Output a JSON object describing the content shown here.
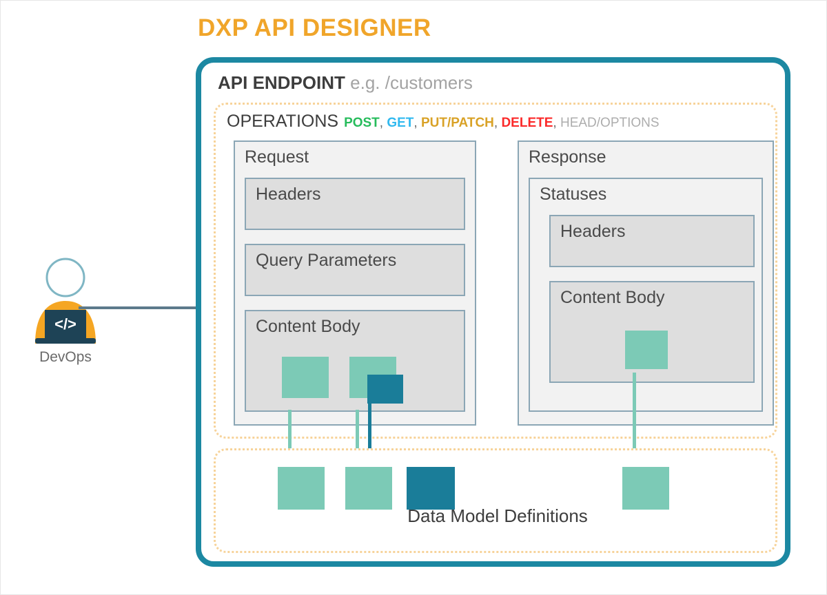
{
  "title": "DXP API DESIGNER",
  "actor": {
    "label": "DevOps",
    "icon": "developer-avatar-icon",
    "code_glyph": "</>",
    "shirt_color": "#f5a623",
    "laptop_color": "#1e4356"
  },
  "endpoint": {
    "title_strong": "API ENDPOINT",
    "title_muted": "e.g. /customers"
  },
  "operations": {
    "label": "OPERATIONS",
    "methods": [
      {
        "name": "POST",
        "color": "#27bc5c"
      },
      {
        "name": "GET",
        "color": "#31b9ef"
      },
      {
        "name": "PUT/PATCH",
        "color": "#d9a227"
      },
      {
        "name": "DELETE",
        "color": "#fb2a2a"
      },
      {
        "name": "HEAD/OPTIONS",
        "color": "#adadad"
      }
    ],
    "separator": ", "
  },
  "request": {
    "label": "Request",
    "items": [
      {
        "label": "Headers"
      },
      {
        "label": "Query Parameters"
      },
      {
        "label": "Content Body"
      }
    ]
  },
  "response": {
    "label": "Response",
    "statuses_label": "Statuses",
    "items": [
      {
        "label": "Headers"
      },
      {
        "label": "Content Body"
      }
    ]
  },
  "data_models": {
    "label": "Data Model Definitions",
    "nodes": [
      {
        "id": "model-1",
        "color": "#7ccab6"
      },
      {
        "id": "model-2",
        "color": "#7ccab6"
      },
      {
        "id": "model-3",
        "color": "#1a7d99"
      },
      {
        "id": "model-4",
        "color": "#7ccab6"
      }
    ]
  },
  "colors": {
    "brand_orange": "#f0a52a",
    "endpoint_border_teal": "#1c88a2",
    "panel_border": "#8ba6b5",
    "panel_fill": "#f2f2f2",
    "inner_fill": "#dedede",
    "square_teal": "#7ccab6",
    "square_dark_teal": "#1a7d99",
    "connector_grey": "#5c7a8c",
    "dotted_orange": "#f7d39a"
  }
}
